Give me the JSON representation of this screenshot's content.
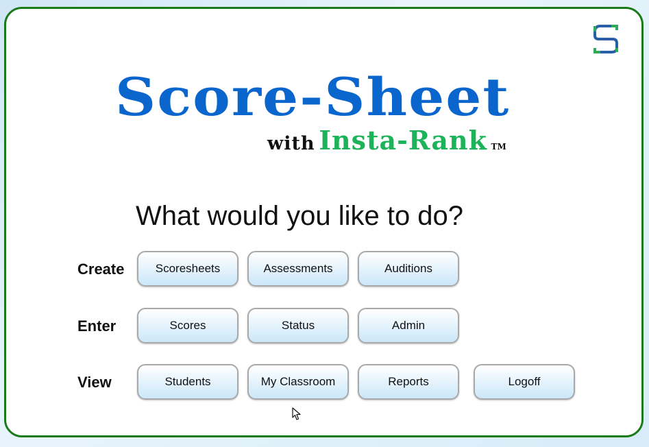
{
  "header": {
    "title": "Score-Sheet",
    "with_text": "with",
    "brand_text": "Insta-Rank",
    "trademark": "TM"
  },
  "question": "What would you like to do?",
  "rows": [
    {
      "label": "Create",
      "buttons": [
        "Scoresheets",
        "Assessments",
        "Auditions"
      ]
    },
    {
      "label": "Enter",
      "buttons": [
        "Scores",
        "Status",
        "Admin"
      ]
    },
    {
      "label": "View",
      "buttons": [
        "Students",
        "My Classroom",
        "Reports",
        "Logoff"
      ]
    }
  ],
  "colors": {
    "title_blue": "#0a66cc",
    "brand_green": "#1db35a",
    "border_green": "#1a7a1a",
    "button_gradient_bottom": "#cbe7f9"
  },
  "icons": {
    "corner_logo": "score-sheet-s-logo-icon",
    "cursor": "mouse-pointer-icon"
  }
}
